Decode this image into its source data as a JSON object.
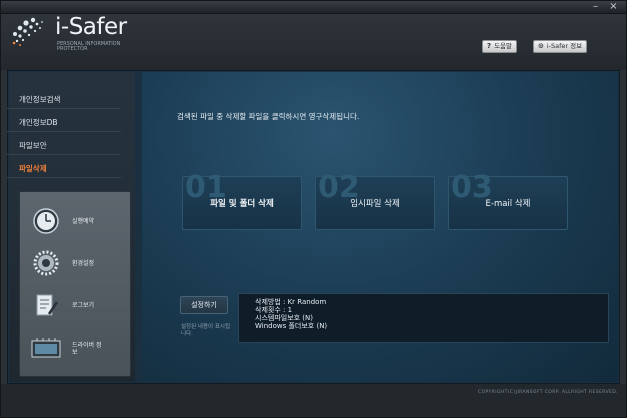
{
  "window": {
    "minimize_glyph": "–",
    "close_glyph": "×"
  },
  "header": {
    "app_name": "i-Safer",
    "app_subtitle": "PERSONAL INFORMATION PROTECTOR",
    "help_button": "도움말",
    "about_button": "i-Safer 정보",
    "help_icon": "question-icon",
    "about_icon": "info-icon"
  },
  "sidebar": {
    "items": [
      {
        "label": "개인정보검색",
        "active": false
      },
      {
        "label": "개인정보DB",
        "active": false
      },
      {
        "label": "파일보안",
        "active": false
      },
      {
        "label": "파일삭제",
        "active": true
      }
    ],
    "tools": [
      {
        "label": "실행예약",
        "icon": "clock-icon"
      },
      {
        "label": "환경설정",
        "icon": "gear-icon"
      },
      {
        "label": "로그보기",
        "icon": "log-icon"
      },
      {
        "label": "드라이버 정보",
        "icon": "driver-icon"
      }
    ]
  },
  "main": {
    "notice": "검색된 파일 중 삭제할 파일을 클릭하시면 영구삭제됩니다.",
    "actions": [
      {
        "num": "01",
        "label": "파일 및 폴더 삭제"
      },
      {
        "num": "02",
        "label": "임시파일 삭제"
      },
      {
        "num": "03",
        "label": "E-mail 삭제"
      }
    ],
    "settings": {
      "button": "설정하기",
      "hint": "설정된 내용이 표시됩니다.",
      "lines": [
        "삭제방법 : Kr Random",
        "삭제횟수 : 1",
        "시스템파일보호 (N)",
        "Windows 폴더보호 (N)"
      ]
    }
  },
  "footer": {
    "copyright": "COPYRIGHT(C)JIRANSOFT CORP. ALLRIGHT RESERVED."
  },
  "colors": {
    "accent": "#f1823a",
    "content_bg": "#1a3a50",
    "sidebar_bg": "#26333e"
  }
}
